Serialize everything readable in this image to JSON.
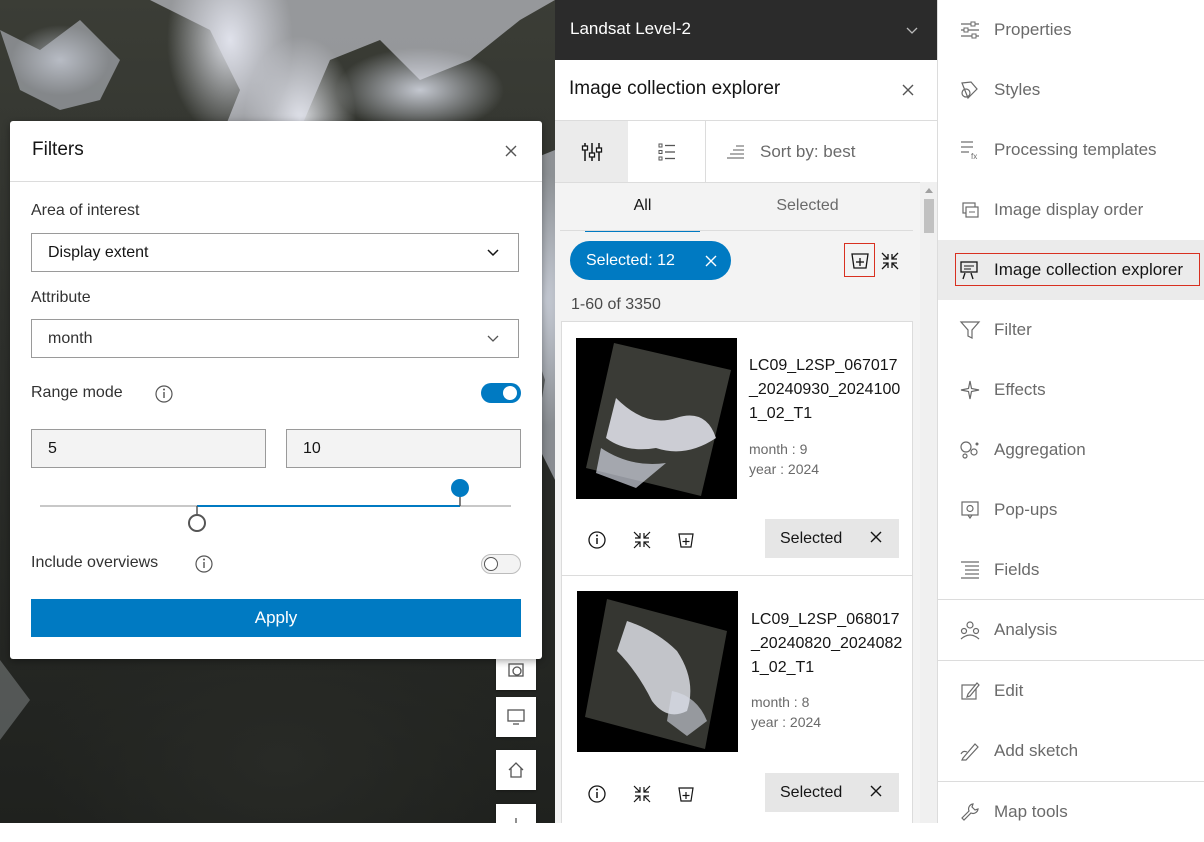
{
  "filters": {
    "title": "Filters",
    "area_label": "Area of interest",
    "area_value": "Display extent",
    "attribute_label": "Attribute",
    "attribute_value": "month",
    "range_mode_label": "Range mode",
    "range_mode_on": true,
    "min_value": "5",
    "max_value": "10",
    "include_overviews_label": "Include overviews",
    "include_overviews_on": false,
    "apply_label": "Apply"
  },
  "explorer": {
    "layer_name": "Landsat Level-2",
    "title": "Image collection explorer",
    "sort_label": "Sort by: best",
    "tabs": [
      "All",
      "Selected"
    ],
    "active_tab": "All",
    "chip_label": "Selected: 12",
    "result_count": "1-60 of 3350",
    "cards": [
      {
        "name": "LC09_L2SP_067017_20240930_20241001_02_T1",
        "month": "month : 9",
        "year": "year : 2024",
        "selected_label": "Selected"
      },
      {
        "name": "LC09_L2SP_068017_20240820_20240821_02_T1",
        "month": "month : 8",
        "year": "year : 2024",
        "selected_label": "Selected"
      }
    ]
  },
  "actions": {
    "items": [
      {
        "label": "Properties",
        "icon": "sliders-icon"
      },
      {
        "label": "Styles",
        "icon": "styles-icon"
      },
      {
        "label": "Processing templates",
        "icon": "processing-templates-icon"
      },
      {
        "label": "Image display order",
        "icon": "display-order-icon"
      },
      {
        "label": "Image collection explorer",
        "icon": "collection-explorer-icon"
      },
      {
        "label": "Filter",
        "icon": "filter-icon"
      },
      {
        "label": "Effects",
        "icon": "effects-icon"
      },
      {
        "label": "Aggregation",
        "icon": "aggregation-icon"
      },
      {
        "label": "Pop-ups",
        "icon": "popup-icon"
      },
      {
        "label": "Fields",
        "icon": "fields-icon"
      },
      {
        "label": "Analysis",
        "icon": "analysis-icon"
      },
      {
        "label": "Edit",
        "icon": "edit-icon"
      },
      {
        "label": "Add sketch",
        "icon": "sketch-icon"
      },
      {
        "label": "Map tools",
        "icon": "wrench-icon"
      }
    ],
    "active": "Image collection explorer"
  },
  "colors": {
    "accent": "#007ac2",
    "highlight_box": "#d83020"
  }
}
